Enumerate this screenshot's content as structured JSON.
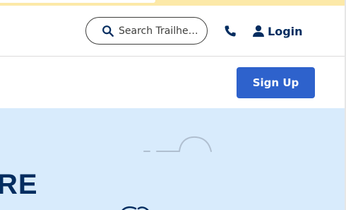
{
  "header": {
    "search": {
      "placeholder": "Search Trailhe…",
      "icon": "search-icon"
    },
    "phone": {
      "icon": "phone-icon"
    },
    "login": {
      "label": "Login",
      "icon": "user-icon"
    }
  },
  "sub_nav": {
    "sign_up_label": "Sign Up"
  },
  "hero": {
    "heading_fragment": "RE"
  },
  "colors": {
    "brand_navy": "#032d60",
    "cta_blue": "#2e62cc",
    "hero_bg": "#d8ebfc",
    "announce_yellow": "#fce9a8"
  }
}
